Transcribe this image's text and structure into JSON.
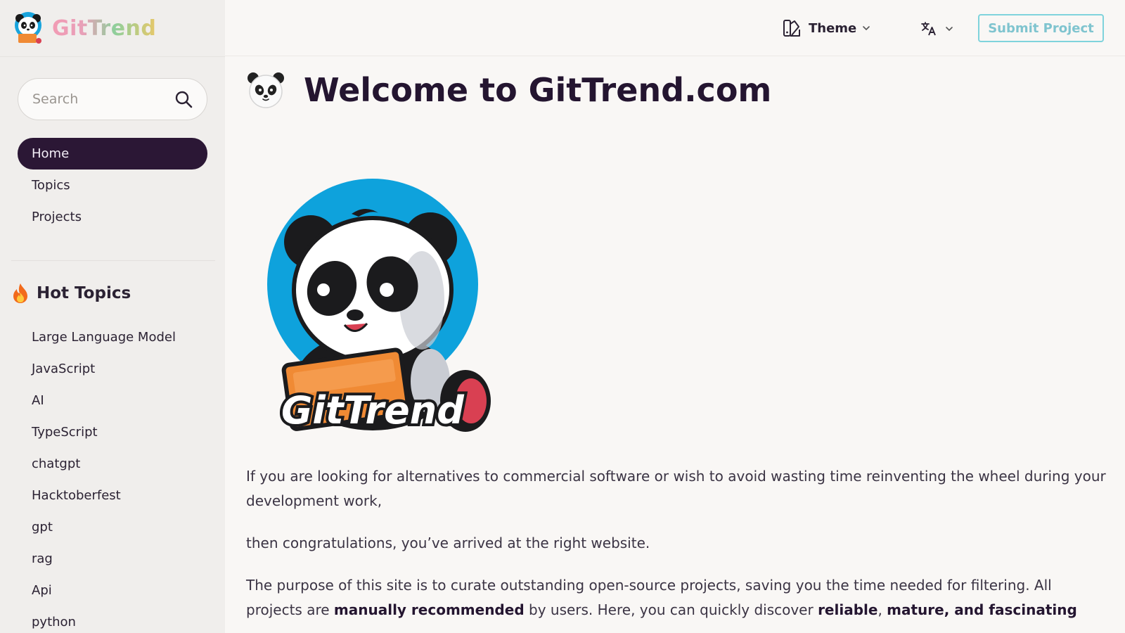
{
  "brand": {
    "name": "GitTrend"
  },
  "search": {
    "placeholder": "Search"
  },
  "nav": {
    "items": [
      {
        "label": "Home"
      },
      {
        "label": "Topics"
      },
      {
        "label": "Projects"
      }
    ]
  },
  "hot_topics": {
    "title": "Hot Topics",
    "items": [
      {
        "label": "Large Language Model"
      },
      {
        "label": "JavaScript"
      },
      {
        "label": "AI"
      },
      {
        "label": "TypeScript"
      },
      {
        "label": "chatgpt"
      },
      {
        "label": "Hacktoberfest"
      },
      {
        "label": "gpt"
      },
      {
        "label": "rag"
      },
      {
        "label": "Api"
      },
      {
        "label": "python"
      }
    ]
  },
  "header": {
    "theme_label": "Theme",
    "submit_label": "Submit Project"
  },
  "main": {
    "title": "Welcome to GitTrend.com",
    "hero_logo_text": "GitTrend",
    "p1": "If you are looking for alternatives to commercial software or wish to avoid wasting time reinventing the wheel during your development work,",
    "p2": "then congratulations, you’ve arrived at the right website.",
    "p3_a": "The purpose of this site is to curate outstanding open-source projects, saving you the time needed for filtering. All projects are ",
    "p3_b": "manually recommended",
    "p3_c": " by users. Here, you can quickly discover ",
    "p3_d": "reliable",
    "p3_e": ", ",
    "p3_f": "mature, and fascinating"
  },
  "colors": {
    "accent_dark": "#2b1735",
    "submit_border": "#7fd3dc",
    "hero_circle": "#0ea2dc"
  },
  "icons": {
    "search": "search-icon",
    "theme": "theme-icon",
    "language": "translate-icon",
    "hot": "fire-icon",
    "chevron": "chevron-down-icon"
  }
}
